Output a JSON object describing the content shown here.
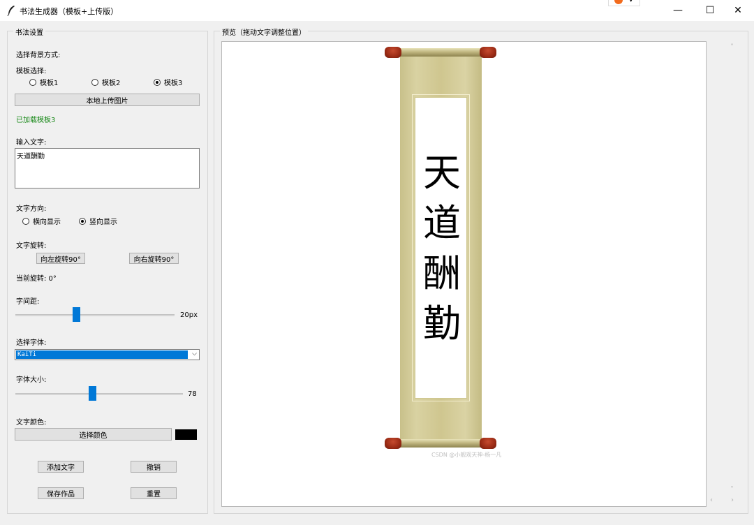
{
  "window": {
    "title": "书法生成器（模板+上传版）",
    "minimize_glyph": "—",
    "maximize_glyph": "☐",
    "close_glyph": "✕"
  },
  "left_panel": {
    "group_title": "书法设置",
    "background_label": "选择背景方式:",
    "template_label": "模板选择:",
    "templates": [
      {
        "label": "模板1",
        "selected": false
      },
      {
        "label": "模板2",
        "selected": false
      },
      {
        "label": "模板3",
        "selected": true
      }
    ],
    "upload_button": "本地上传图片",
    "status_text": "已加载模板3",
    "status_color": "#1a8a1a",
    "input_label": "输入文字:",
    "input_value": "天道酬勤",
    "direction_label": "文字方向:",
    "directions": [
      {
        "label": "横向显示",
        "selected": false
      },
      {
        "label": "竖向显示",
        "selected": true
      }
    ],
    "rotation_label": "文字旋转:",
    "rotate_left_button": "向左旋转90°",
    "rotate_right_button": "向右旋转90°",
    "current_rotation": "当前旋转: 0°",
    "spacing_label": "字间距:",
    "spacing_value_text": "20px",
    "spacing_fraction": 0.38,
    "font_label": "选择字体:",
    "font_selected": "KaiTi",
    "font_size_label": "字体大小:",
    "font_size_value": "78",
    "font_size_fraction": 0.46,
    "color_label": "文字颜色:",
    "color_button": "选择颜色",
    "text_color": "#000000",
    "add_text_button": "添加文字",
    "undo_button": "撤销",
    "save_button": "保存作品",
    "reset_button": "重置"
  },
  "preview": {
    "group_title": "预览（拖动文字调整位置）",
    "characters": [
      "天",
      "道",
      "酬",
      "勤"
    ],
    "watermark": "CSDN @小舰观天神-杨一凡",
    "scroll_arrow_up": "˄",
    "scroll_arrow_down": "˅",
    "scroll_arrow_left": "‹",
    "scroll_arrow_right": "›"
  },
  "colors": {
    "accent": "#0078d7",
    "scroll_silk": "#d3cb97",
    "rod_cap": "#9a2b15"
  }
}
